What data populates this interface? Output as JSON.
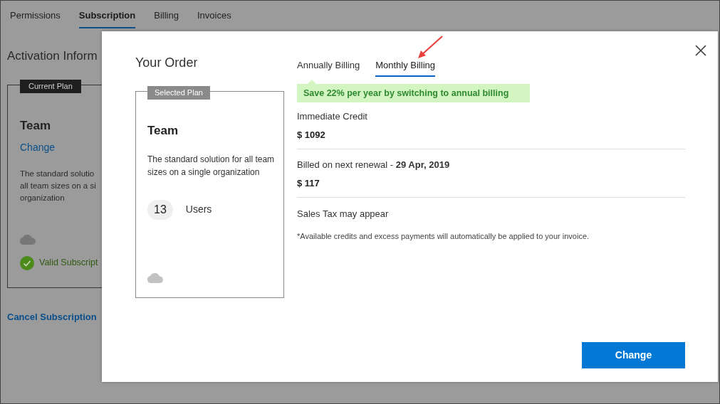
{
  "page_tabs": [
    {
      "label": "Permissions",
      "selected": false
    },
    {
      "label": "Subscription",
      "selected": true
    },
    {
      "label": "Billing",
      "selected": false
    },
    {
      "label": "Invoices",
      "selected": false
    }
  ],
  "page": {
    "heading": "Activation Inform",
    "current_plan": {
      "badge": "Current Plan",
      "name": "Team",
      "change_link": "Change",
      "description_lines": [
        "The standard solutio",
        "all team sizes on a si",
        "organization"
      ],
      "status": "Valid Subscript"
    },
    "cancel_link": "Cancel Subscription"
  },
  "dialog": {
    "title": "Your Order",
    "selected_plan": {
      "badge": "Selected Plan",
      "name": "Team",
      "description": "The standard solution for all team sizes on a single organization",
      "users_count": "13",
      "users_label": "Users"
    },
    "billing_tabs": [
      {
        "label": "Annually Billing",
        "selected": false
      },
      {
        "label": "Monthly Billing",
        "selected": true
      }
    ],
    "savings_note": "Save 22% per year by switching to annual billing",
    "sections": [
      {
        "label": "Immediate Credit",
        "amount": "$ 1092"
      },
      {
        "label": "Billed on next renewal - **29 Apr, 2019**",
        "amount": "$ 117"
      }
    ],
    "tax_note": "Sales Tax may appear",
    "footnote": "*Available credits and excess payments will automatically be applied to your invoice.",
    "primary_button": "Change"
  }
}
